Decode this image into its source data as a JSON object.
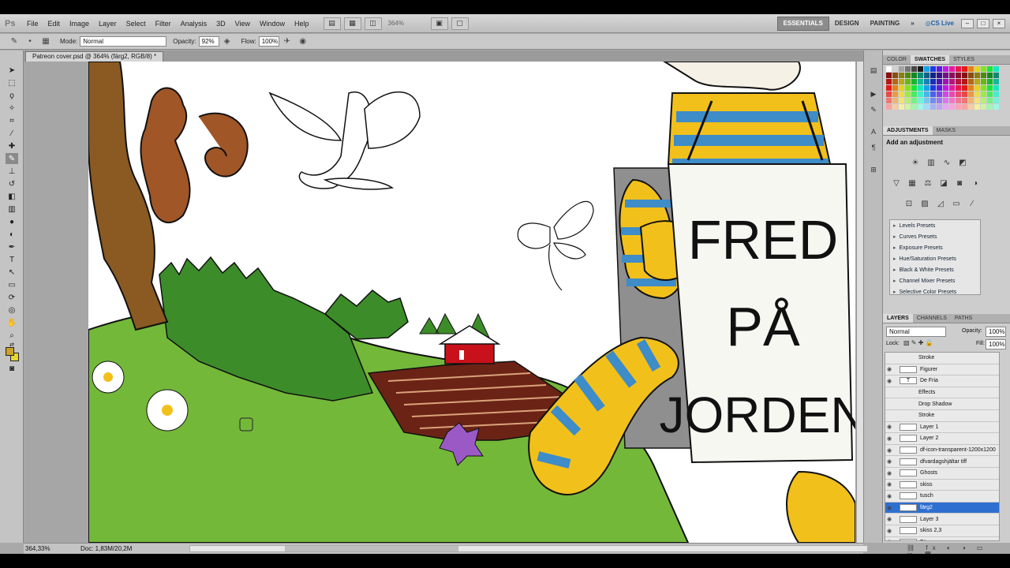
{
  "app": {
    "logo": "Ps"
  },
  "menu": [
    "File",
    "Edit",
    "Image",
    "Layer",
    "Select",
    "Filter",
    "Analysis",
    "3D",
    "View",
    "Window",
    "Help"
  ],
  "menubar": {
    "zoom": "364%"
  },
  "workspaces": [
    "ESSENTIALS",
    "DESIGN",
    "PAINTING"
  ],
  "workspace_more": "»",
  "cslive": "CS Live",
  "options": {
    "mode_label": "Mode:",
    "mode_value": "Normal",
    "opacity_label": "Opacity:",
    "opacity_value": "92%",
    "flow_label": "Flow:",
    "flow_value": "100%"
  },
  "document": {
    "tab_title": "Patreon cover.psd @ 364% (färg2, RGB/8) *",
    "sign_text": [
      "FRED",
      "PÅ",
      "JORDEN"
    ]
  },
  "status": {
    "zoom": "364,33%",
    "doc": "Doc: 1,83M/20,2M"
  },
  "panels": {
    "color_tabs": [
      "COLOR",
      "SWATCHES",
      "STYLES"
    ],
    "adjust_tabs": [
      "ADJUSTMENTS",
      "MASKS"
    ],
    "adjust_title": "Add an adjustment",
    "presets": [
      "Levels Presets",
      "Curves Presets",
      "Exposure Presets",
      "Hue/Saturation Presets",
      "Black & White Presets",
      "Channel Mixer Presets",
      "Selective Color Presets"
    ],
    "layers_tabs": [
      "LAYERS",
      "CHANNELS",
      "PATHS"
    ],
    "blend_mode": "Normal",
    "opacity_label": "Opacity:",
    "opacity_value": "100%",
    "lock_label": "Lock:",
    "fill_label": "Fill:",
    "fill_value": "100%",
    "layers": [
      {
        "name": "Stroke",
        "fx": true
      },
      {
        "name": "Figurer",
        "fx": false
      },
      {
        "name": "De Fria",
        "fx": false,
        "text": true
      },
      {
        "name": "Effects",
        "fx": true
      },
      {
        "name": "Drop Shadow",
        "fx": true
      },
      {
        "name": "Stroke",
        "fx": true
      },
      {
        "name": "Layer 1",
        "fx": false
      },
      {
        "name": "Layer 2",
        "fx": false
      },
      {
        "name": "df-icon-transparent-1200x1200",
        "fx": false
      },
      {
        "name": "dfvardagshjältar tiff",
        "fx": false
      },
      {
        "name": "Ghosts",
        "fx": false
      },
      {
        "name": "skiss",
        "fx": false
      },
      {
        "name": "tusch",
        "fx": false
      },
      {
        "name": "färg2",
        "fx": false,
        "selected": true
      },
      {
        "name": "Layer 3",
        "fx": false
      },
      {
        "name": "skiss 2,3",
        "fx": false
      },
      {
        "name": "Färg",
        "fx": false
      }
    ]
  },
  "colors": {
    "foreground": "#c9a227",
    "background": "#e8d630",
    "sky": "#ffffff",
    "grass": "#74b83a",
    "dark_grass": "#3d8c2a",
    "field": "#6b2316",
    "barn": "#c8111a",
    "squirrel": "#a05626",
    "tree": "#8a5a22",
    "stripe_yellow": "#f2c01b",
    "stripe_blue": "#3e8cc8",
    "flower_purple": "#9b59c6"
  }
}
